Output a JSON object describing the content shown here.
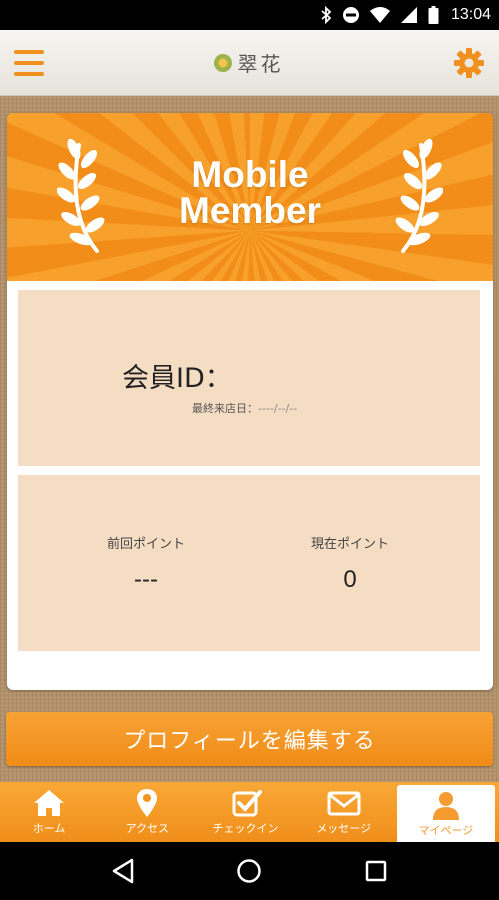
{
  "status_bar": {
    "time": "13:04",
    "icons": [
      "bluetooth-icon",
      "do-not-disturb-icon",
      "wifi-icon",
      "signal-icon",
      "battery-icon"
    ]
  },
  "header": {
    "title": "翠花",
    "menu_icon": "hamburger-menu-icon",
    "settings_icon": "gear-icon",
    "accent_color": "#f0901e"
  },
  "banner": {
    "line1": "Mobile",
    "line2": "Member",
    "background_color": "#f39520"
  },
  "member": {
    "id_label": "会員ID：",
    "last_visit_label": "最終来店日：",
    "last_visit_value": "----/--/--"
  },
  "points": {
    "previous_label": "前回ポイント",
    "previous_value": "---",
    "current_label": "現在ポイント",
    "current_value": "0"
  },
  "edit_profile_label": "プロフィールを編集する",
  "tabs": [
    {
      "label": "ホーム",
      "icon": "home-icon",
      "active": false
    },
    {
      "label": "アクセス",
      "icon": "map-pin-icon",
      "active": false
    },
    {
      "label": "チェックイン",
      "icon": "checkbox-icon",
      "active": false
    },
    {
      "label": "メッセージ",
      "icon": "envelope-icon",
      "active": false
    },
    {
      "label": "マイページ",
      "icon": "person-icon",
      "active": true
    }
  ],
  "nav": [
    "back-icon",
    "home-circle-icon",
    "recents-icon"
  ]
}
